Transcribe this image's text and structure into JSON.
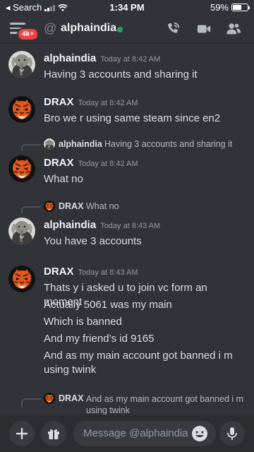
{
  "status_bar": {
    "back_label": "◂ Search",
    "time": "1:34 PM",
    "battery": "59%",
    "battery_level": 0.59
  },
  "header": {
    "badge": "4k+",
    "at": "@",
    "channel": "alphaindia"
  },
  "messages": [
    {
      "author": "alphaindia",
      "time": "Today at 8:42 AM",
      "lines": [
        "Having 3 accounts and sharing it"
      ]
    },
    {
      "author": "DRAX",
      "time": "Today at 8:42 AM",
      "lines": [
        "Bro we r using same steam since en2"
      ]
    },
    {
      "reply_to": {
        "author": "alphaindia",
        "text": "Having 3 accounts and sharing it"
      },
      "author": "DRAX",
      "time": "Today at 8:42 AM",
      "lines": [
        "What no"
      ]
    },
    {
      "reply_to": {
        "author": "DRAX",
        "text": "What no"
      },
      "author": "alphaindia",
      "time": "Today at 8:43 AM",
      "lines": [
        "You have 3 accounts"
      ]
    },
    {
      "author": "DRAX",
      "time": "Today at 8:43 AM",
      "lines": [
        "Thats y i asked u to join vc form an moment",
        "Actually 5061 was my main",
        "Which is banned",
        "And my friend’s id 9165",
        "And as my main account got banned i m",
        "using twink"
      ]
    },
    {
      "reply_to": {
        "author": "DRAX",
        "text": "And as my main account got banned i m using twink"
      }
    }
  ],
  "composer": {
    "placeholder": "Message @alphaindia"
  },
  "icons": [
    "hamburger-icon",
    "at-icon",
    "call-icon",
    "video-icon",
    "members-icon",
    "plus-icon",
    "gift-icon",
    "emoji-icon",
    "mic-icon"
  ],
  "colors": {
    "background": "#313338",
    "online": "#23a55a",
    "badge": "#f23f43"
  }
}
